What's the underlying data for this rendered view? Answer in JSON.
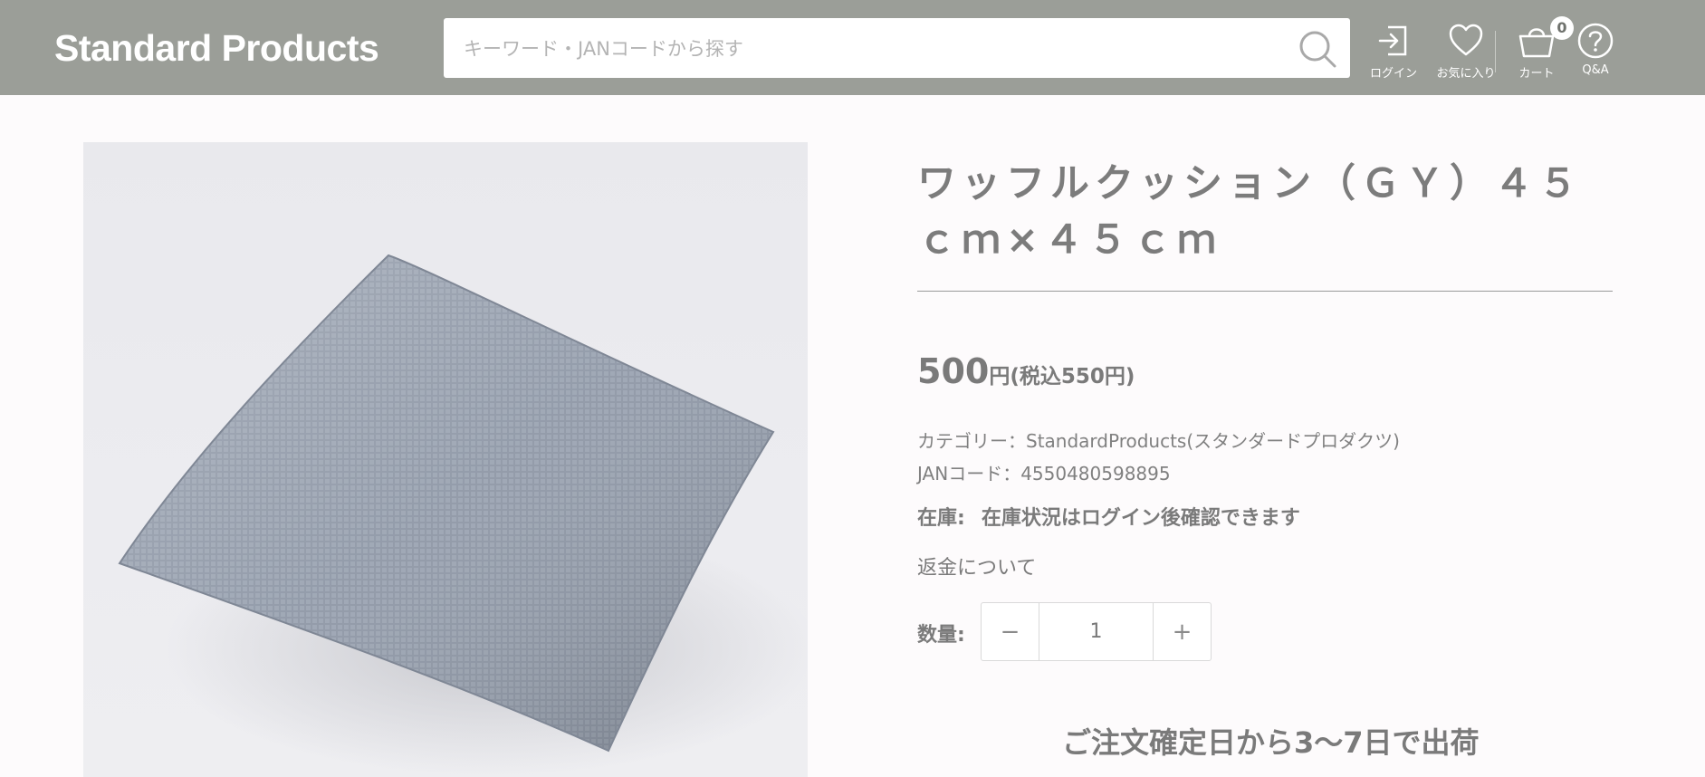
{
  "header": {
    "logo": "Standard Products",
    "search": {
      "placeholder": "キーワード・JANコードから探す",
      "value": ""
    },
    "actions": [
      {
        "icon": "login-icon",
        "label": "ログイン"
      },
      {
        "icon": "heart-icon",
        "label": "お気に入り"
      },
      {
        "icon": "cart-icon",
        "label": "カート",
        "badge": "0"
      },
      {
        "icon": "help-icon",
        "label": "Q&A"
      }
    ],
    "colors": {
      "bar": "#9b9e98",
      "text": "#ffffff"
    }
  },
  "product": {
    "title": "ワッフルクッション（ＧＹ）４５ｃｍ×４５ｃｍ",
    "price": {
      "amount": "500",
      "currency": "円",
      "tax_included": "(税込550円)"
    },
    "category": "カテゴリー：StandardProducts(スタンダードプロダクツ)",
    "jan": "JANコード：4550480598895",
    "stock": {
      "label": "在庫:",
      "value": "在庫状況はログイン後確認できます"
    },
    "refund_link": "返金について",
    "quantity": {
      "label": "数量:",
      "value": "1",
      "minus": "−",
      "plus": "+"
    },
    "shipping_note": "ご注文確定日から3〜7日で出荷"
  }
}
